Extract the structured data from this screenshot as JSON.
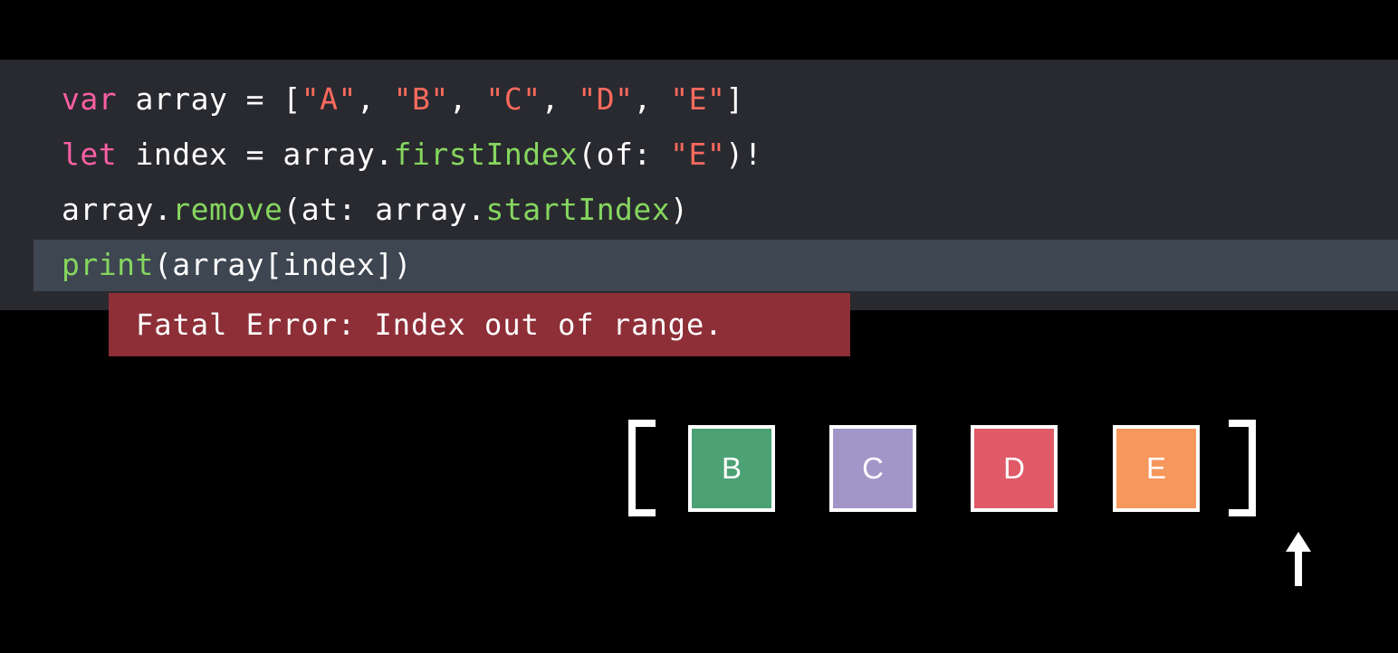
{
  "code": {
    "line1": {
      "keyword": "var",
      "ident": " array = [",
      "s1": "\"A\"",
      "c1": ", ",
      "s2": "\"B\"",
      "c2": ", ",
      "s3": "\"C\"",
      "c3": ", ",
      "s4": "\"D\"",
      "c4": ", ",
      "s5": "\"E\"",
      "close": "]"
    },
    "line2": {
      "keyword": "let",
      "ident": " index = array.",
      "method": "firstIndex",
      "args": "(of: ",
      "str": "\"E\"",
      "close": ")!"
    },
    "line3": {
      "ident": "array.",
      "method": "remove",
      "args": "(at: array.",
      "prop": "startIndex",
      "close": ")"
    },
    "line4": {
      "fn": "print",
      "rest": "(array[index])"
    }
  },
  "error": {
    "message": "Fatal Error: Index out of range."
  },
  "array_diagram": {
    "cells": [
      {
        "label": "B",
        "color": "#4ca274"
      },
      {
        "label": "C",
        "color": "#a296c8"
      },
      {
        "label": "D",
        "color": "#e05a67"
      },
      {
        "label": "E",
        "color": "#f6975b"
      }
    ],
    "pointer": "up-arrow-icon"
  },
  "colors": {
    "background": "#000000",
    "code_panel": "#292a30",
    "highlight_row": "#3d4651",
    "error_box": "#8e2f38",
    "keyword": "#fc5fa3",
    "string": "#fc6a5d",
    "function": "#86d65f"
  }
}
